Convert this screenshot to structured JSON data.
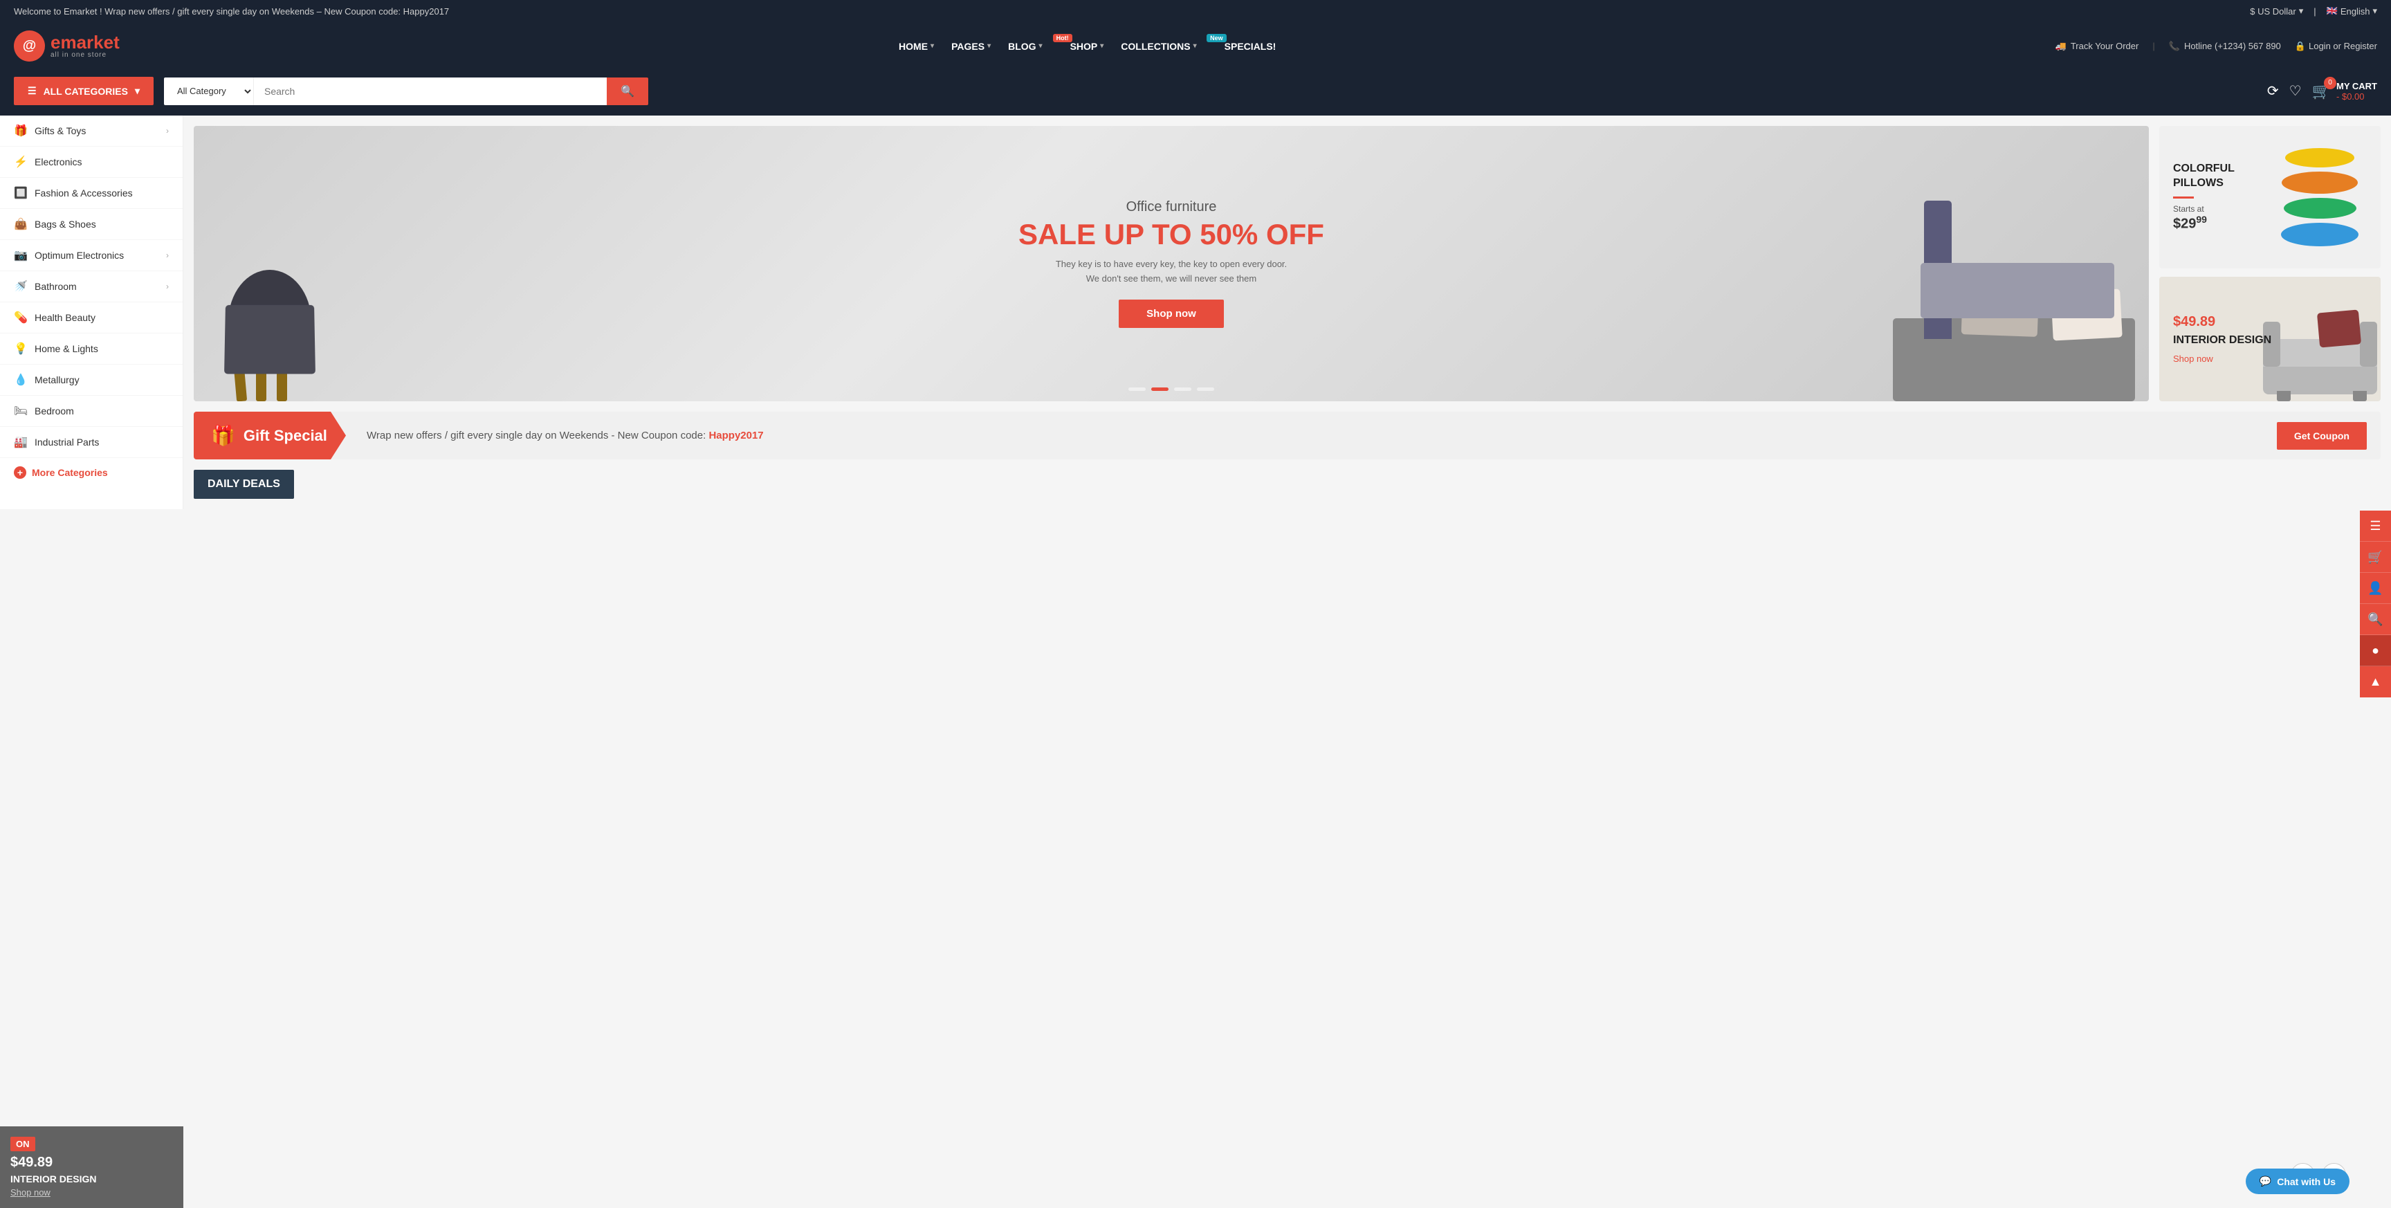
{
  "announcement": {
    "text": "Welcome to Emarket ! Wrap new offers / gift every single day on Weekends – New Coupon code: Happy2017",
    "currency": "$ US Dollar",
    "language": "English"
  },
  "header": {
    "logo": {
      "symbol": "e",
      "brand": "market",
      "brand_prefix": "@",
      "sub": "all in one store"
    },
    "nav": [
      {
        "label": "HOME",
        "has_dropdown": true
      },
      {
        "label": "PAGES",
        "has_dropdown": true
      },
      {
        "label": "BLOG",
        "has_dropdown": true,
        "badge": "Hot!",
        "badge_color": "red"
      },
      {
        "label": "SHOP",
        "has_dropdown": true
      },
      {
        "label": "COLLECTIONS",
        "has_dropdown": true,
        "badge": "New",
        "badge_color": "blue"
      },
      {
        "label": "SPECIALS!",
        "has_dropdown": false
      }
    ],
    "track_order": "Track Your Order",
    "hotline": "Hotline (+1234) 567 890",
    "login": "Login or Register"
  },
  "search": {
    "all_categories_label": "ALL CATEGORIES",
    "category_placeholder": "All Category",
    "search_placeholder": "Search",
    "cart_label": "MY CART",
    "cart_count": "0",
    "cart_price": "$0.00"
  },
  "sidebar": {
    "items": [
      {
        "label": "Gifts & Toys",
        "icon": "🎁",
        "has_arrow": true
      },
      {
        "label": "Electronics",
        "icon": "⚡",
        "has_arrow": false
      },
      {
        "label": "Fashion & Accessories",
        "icon": "🔲",
        "has_arrow": false
      },
      {
        "label": "Bags & Shoes",
        "icon": "👜",
        "has_arrow": false
      },
      {
        "label": "Optimum Electronics",
        "icon": "📷",
        "has_arrow": true
      },
      {
        "label": "Bathroom",
        "icon": "🚿",
        "has_arrow": true
      },
      {
        "label": "Health Beauty",
        "icon": "💊",
        "has_arrow": false
      },
      {
        "label": "Home & Lights",
        "icon": "💡",
        "has_arrow": false
      },
      {
        "label": "Metallurgy",
        "icon": "💧",
        "has_arrow": false
      },
      {
        "label": "Bedroom",
        "icon": "🛏",
        "has_arrow": false
      },
      {
        "label": "Industrial Parts",
        "icon": "🏭",
        "has_arrow": false
      }
    ],
    "more_categories": "More Categories"
  },
  "hero": {
    "subtitle": "Office furniture",
    "title": "SALE UP TO 50% OFF",
    "description_line1": "They key is to have every key, the key to open every door.",
    "description_line2": "We don't see them, we will never see them",
    "button": "Shop now",
    "dots": [
      "inactive",
      "active",
      "inactive",
      "inactive"
    ]
  },
  "side_banners": [
    {
      "title": "COLORFUL\nPILLOWS",
      "price_label": "Starts at",
      "price_main": "$29",
      "price_cents": "99"
    },
    {
      "price": "$49.89",
      "title": "INTERIOR DESIGN",
      "link": "Shop now"
    }
  ],
  "gift_bar": {
    "label": "Gift Special",
    "icon": "🎁",
    "message_prefix": "Wrap new offers / gift every single day on Weekends - New Coupon code: ",
    "coupon_code": "Happy2017",
    "button": "Get Coupon"
  },
  "daily_deals": {
    "title": "DAILY DEALS"
  },
  "left_preview": {
    "on_label": "ON",
    "price": "$49.89",
    "title": "INTERIOR DESIGN",
    "link": "Shop now"
  },
  "floating_buttons": [
    {
      "icon": "☰",
      "name": "menu"
    },
    {
      "icon": "🛒",
      "name": "cart"
    },
    {
      "icon": "👤",
      "name": "user"
    },
    {
      "icon": "🔍",
      "name": "search"
    },
    {
      "icon": "🔴",
      "name": "compare"
    },
    {
      "icon": "▲",
      "name": "top"
    }
  ],
  "chat": {
    "label": "Chat with Us"
  },
  "pagination_arrows": {
    "prev": "❮",
    "next": "❯"
  }
}
